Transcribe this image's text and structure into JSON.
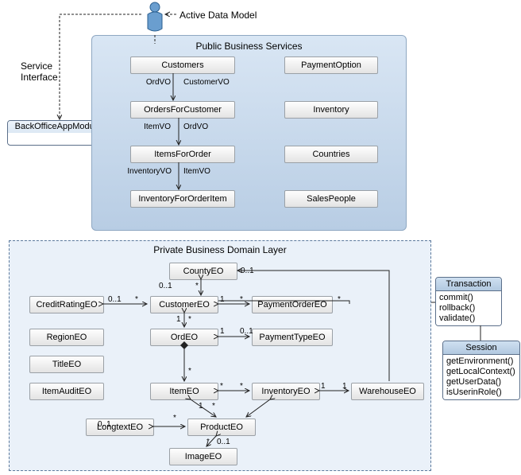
{
  "topLabel": "Active Data Model",
  "serviceInterface": "Service\nInterface",
  "backOfficeAppModule": "BackOfficeAppModule",
  "pbs": {
    "title": "Public Business Services",
    "left": [
      "Customers",
      "OrdersForCustomer",
      "ItemsForOrder",
      "InventoryForOrderItem"
    ],
    "right": [
      "PaymentOption",
      "Inventory",
      "Countries",
      "SalesPeople"
    ],
    "flow": [
      {
        "a": "OrdVO",
        "b": "CustomerVO"
      },
      {
        "a": "ItemVO",
        "b": "OrdVO"
      },
      {
        "a": "InventoryVO",
        "b": "ItemVO"
      }
    ]
  },
  "domain": {
    "title": "Private Business Domain Layer",
    "entities": {
      "county": "CountyEO",
      "creditRating": "CreditRatingEO",
      "customer": "CustomerEO",
      "paymentOrder": "PaymentOrderEO",
      "region": "RegionEO",
      "ord": "OrdEO",
      "paymentType": "PaymentTypeEO",
      "title": "TitleEO",
      "itemAudit": "ItemAuditEO",
      "item": "ItemEO",
      "inventory": "InventoryEO",
      "warehouse": "WarehouseEO",
      "longtext": "LongtextEO",
      "product": "ProductEO",
      "image": "ImageEO"
    },
    "multiplicities": {
      "one": "1",
      "zeroOne": "0..1",
      "star": "*"
    }
  },
  "transaction": {
    "name": "Transaction",
    "methods": [
      "commit()",
      "rollback()",
      "validate()"
    ]
  },
  "session": {
    "name": "Session",
    "methods": [
      "getEnvironment()",
      "getLocalContext()",
      "getUserData()",
      "isUserinRole()"
    ]
  }
}
